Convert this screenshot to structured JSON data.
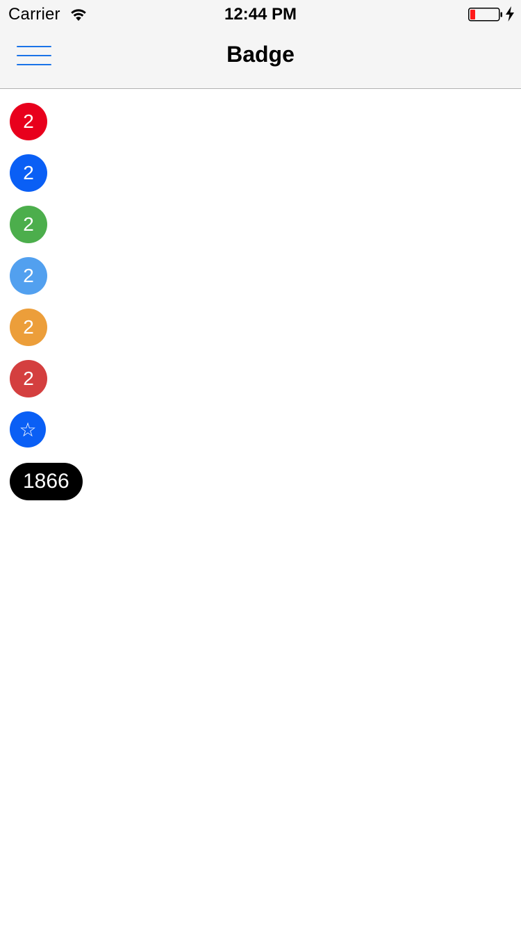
{
  "status_bar": {
    "carrier": "Carrier",
    "time": "12:44 PM",
    "wifi_icon": "wifi-icon",
    "battery_icon": "battery-low-icon",
    "charging_icon": "charging-bolt-icon"
  },
  "nav": {
    "title": "Badge",
    "menu_icon": "hamburger-menu-icon",
    "accent_color": "#1a73e8"
  },
  "badges": [
    {
      "label": "2",
      "color": "#e8001c"
    },
    {
      "label": "2",
      "color": "#0a5ff5"
    },
    {
      "label": "2",
      "color": "#4cae4c"
    },
    {
      "label": "2",
      "color": "#52a0ef"
    },
    {
      "label": "2",
      "color": "#ec9e3a"
    },
    {
      "label": "2",
      "color": "#d43f3f"
    },
    {
      "label": "☆",
      "color": "#0a5ff5",
      "icon": "star-icon"
    },
    {
      "label": "1866",
      "color": "#000000"
    }
  ]
}
